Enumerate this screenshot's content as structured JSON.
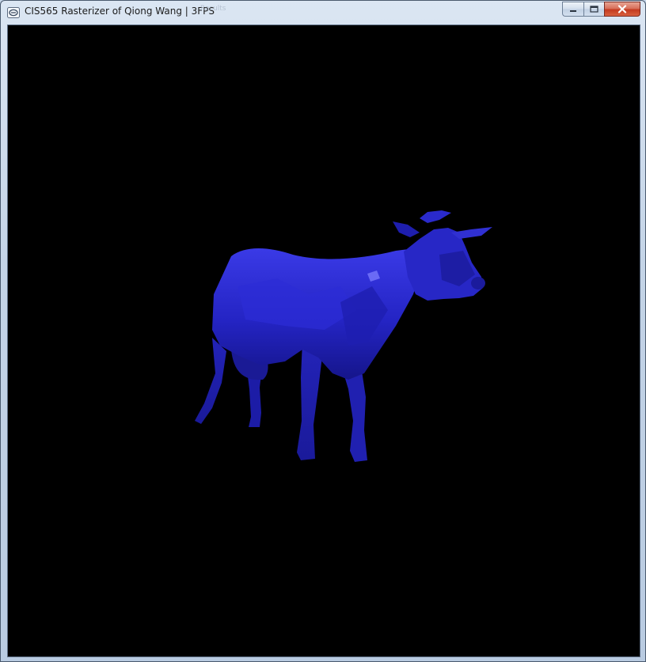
{
  "window": {
    "title": "CIS565 Rasterizer of Qiong Wang | 3FPS",
    "ghost_title": "Results"
  },
  "controls": {
    "minimize": "minimize-icon",
    "maximize": "maximize-icon",
    "close": "close-icon"
  },
  "scene": {
    "background_color": "#000000",
    "model_color": "#2323c8",
    "model": "cow"
  }
}
